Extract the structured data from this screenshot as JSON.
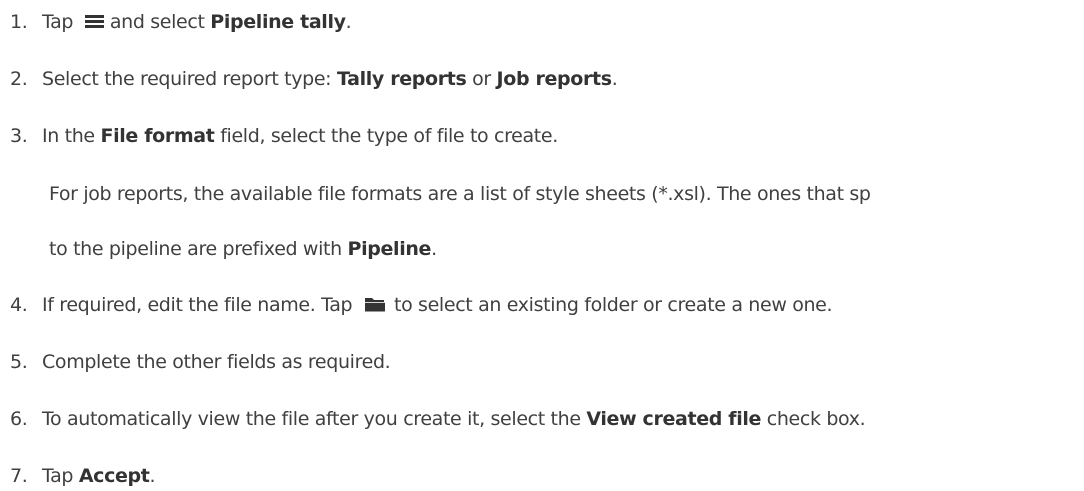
{
  "steps": [
    {
      "num": "1.",
      "a": "Tap",
      "icon": "menu-icon",
      "b": "and select ",
      "bold1": "Pipeline tally",
      "c": "."
    },
    {
      "num": "2.",
      "a": "Select the required report type: ",
      "bold1": "Tally reports",
      "b": " or ",
      "bold2": "Job reports",
      "c": "."
    },
    {
      "num": "3.",
      "a": "In the ",
      "bold1": "File format",
      "b": " field, select the type of file to create."
    },
    {
      "note_line1": "For job reports, the available file formats are a list of style sheets (*.xsl). The ones that sp",
      "note_line2_a": "to the pipeline are prefixed with ",
      "note_line2_bold": "Pipeline",
      "note_line2_c": "."
    },
    {
      "num": "4.",
      "a": "If required, edit the file name. Tap",
      "icon": "folder-icon",
      "b": "to select an existing folder or create a new one."
    },
    {
      "num": "5.",
      "a": "Complete the other fields as required."
    },
    {
      "num": "6.",
      "a": "To automatically view the file after you create it, select the ",
      "bold1": "View created file",
      "b": " check box."
    },
    {
      "num": "7.",
      "a": "Tap ",
      "bold1": "Accept",
      "b": "."
    }
  ]
}
